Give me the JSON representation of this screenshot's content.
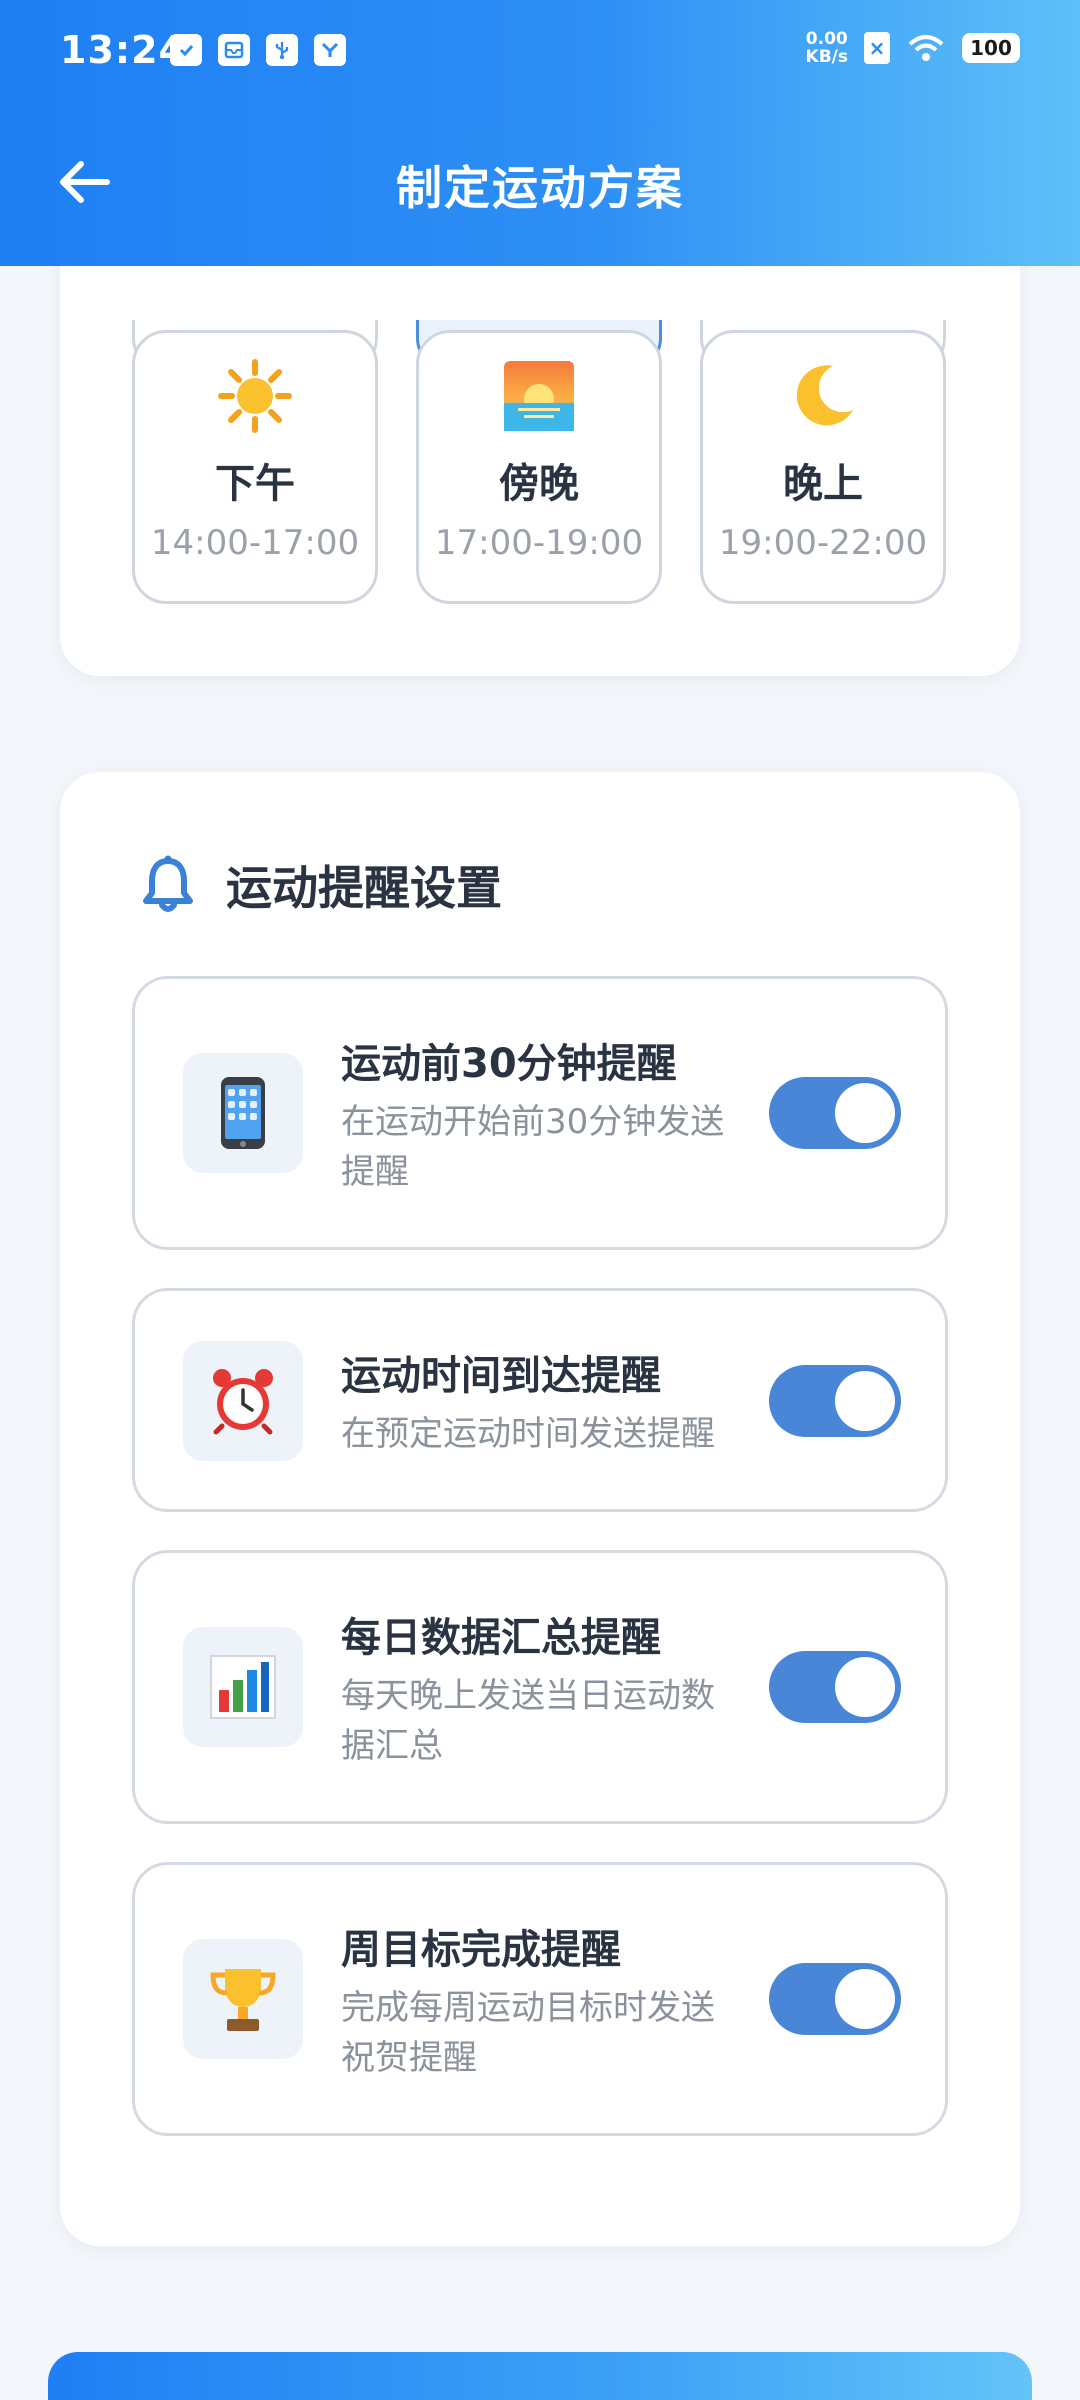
{
  "status_bar": {
    "time": "13:24",
    "net_speed_value": "0.00",
    "net_speed_unit": "KB/s",
    "battery": "100",
    "icons": [
      "clipboard-check-icon",
      "inbox-icon",
      "usb-icon",
      "bird-app-icon",
      "sim-off-icon",
      "wifi-icon",
      "battery-icon"
    ]
  },
  "header": {
    "title": "制定运动方案",
    "back_icon": "arrow-left-icon"
  },
  "time_slots": [
    {
      "label": "下午",
      "range": "14:00-17:00",
      "icon": "sun-icon"
    },
    {
      "label": "傍晚",
      "range": "17:00-19:00",
      "icon": "sunset-icon"
    },
    {
      "label": "晚上",
      "range": "19:00-22:00",
      "icon": "crescent-moon-icon"
    }
  ],
  "reminders": {
    "section_title": "运动提醒设置",
    "section_icon": "bell-icon",
    "items": [
      {
        "title": "运动前30分钟提醒",
        "desc_lines": [
          "在运动开始前30分钟发送",
          "提醒"
        ],
        "icon": "mobile-phone-icon",
        "enabled": true
      },
      {
        "title": "运动时间到达提醒",
        "desc_lines": [
          "在预定运动时间发送提醒"
        ],
        "icon": "alarm-clock-icon",
        "enabled": true
      },
      {
        "title": "每日数据汇总提醒",
        "desc_lines": [
          "每天晚上发送当日运动数",
          "据汇总"
        ],
        "icon": "bar-chart-icon",
        "enabled": true
      },
      {
        "title": "周目标完成提醒",
        "desc_lines": [
          "完成每周运动目标时发送",
          "祝贺提醒"
        ],
        "icon": "trophy-icon",
        "enabled": true
      }
    ]
  },
  "colors": {
    "header_gradient_start": "#1e7ff3",
    "header_gradient_end": "#5ec0f8",
    "toggle_on": "#4a86d8",
    "title_text": "#2a3342",
    "muted_text": "#8a929c"
  }
}
